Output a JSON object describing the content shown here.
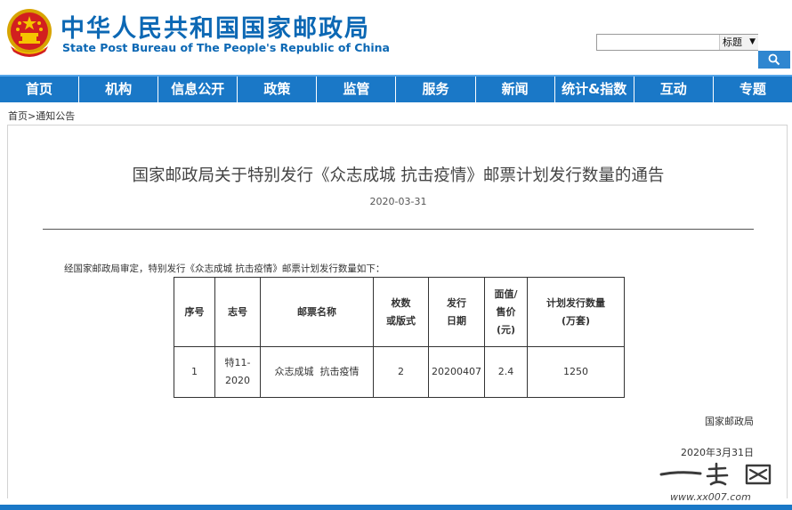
{
  "header": {
    "emblem_icon": "national-emblem",
    "title_cn": "中华人民共和国国家邮政局",
    "title_en": "State Post Bureau of The People's Republic of China",
    "brand_color": "#0c68b4"
  },
  "search": {
    "value": "",
    "select_value": "标题",
    "button_icon": "search-icon"
  },
  "nav": {
    "color": "#1a78c7",
    "items": [
      "首页",
      "机构",
      "信息公开",
      "政策",
      "监管",
      "服务",
      "新闻",
      "统计&指数",
      "互动",
      "专题"
    ]
  },
  "breadcrumb": {
    "home": "首页",
    "separator": ">",
    "current": "通知公告"
  },
  "article": {
    "title": "国家邮政局关于特别发行《众志成城 抗击疫情》邮票计划发行数量的通告",
    "date": "2020-03-31",
    "intro": "经国家邮政局审定，特别发行《众志成城 抗击疫情》邮票计划发行数量如下：",
    "table": {
      "headers": {
        "seq": "序号",
        "code": "志号",
        "name": "邮票名称",
        "count": [
          "枚数",
          "或版式"
        ],
        "issue_date": [
          "发行",
          "日期"
        ],
        "price": [
          "面值/",
          "售价",
          "(元)"
        ],
        "quantity": [
          "计划发行数量",
          "(万套)"
        ]
      },
      "rows": [
        {
          "seq": "1",
          "code": [
            "特11-",
            "2020"
          ],
          "name": "众志成城  抗击疫情",
          "count": "2",
          "issue_date": "20200407",
          "price": "2.4",
          "quantity": "1250"
        }
      ]
    },
    "signature": "国家邮政局",
    "sign_date": "2020年3月31日"
  },
  "watermark": {
    "text": "一 起 网",
    "url": "www.xx007.com"
  }
}
